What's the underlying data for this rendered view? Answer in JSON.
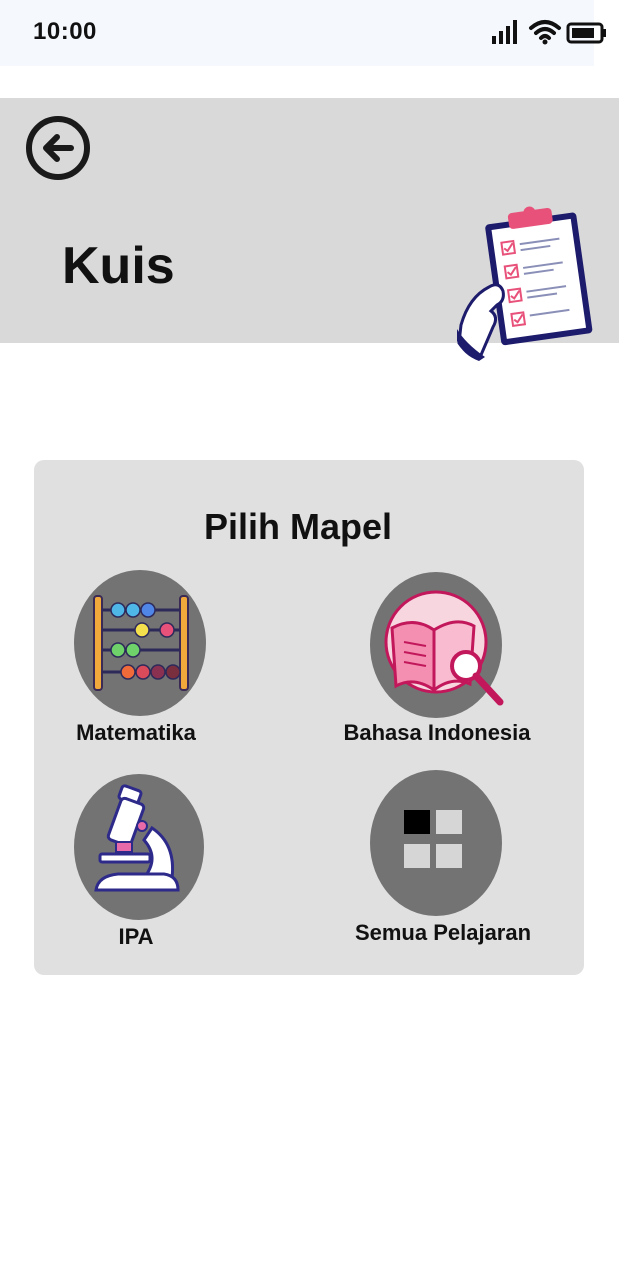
{
  "status_bar": {
    "time": "10:00",
    "icons": [
      "signal-icon",
      "wifi-icon",
      "battery-icon"
    ]
  },
  "header": {
    "title": "Kuis",
    "back_icon": "back-arrow-icon",
    "illustration": "clipboard-checklist-illustration",
    "background_color": "#d9d9d9"
  },
  "subject_panel": {
    "title": "Pilih Mapel",
    "subjects": [
      {
        "label": "Matematika",
        "icon": "abacus-icon"
      },
      {
        "label": "Bahasa Indonesia",
        "icon": "book-magnifier-icon"
      },
      {
        "label": "IPA",
        "icon": "microscope-icon"
      },
      {
        "label": "Semua Pelajaran",
        "icon": "grid-icon"
      }
    ]
  },
  "colors": {
    "circle": "#737373",
    "card": "#e0e0e0",
    "accent_pink": "#e8517a",
    "navy": "#1d1b6b"
  }
}
